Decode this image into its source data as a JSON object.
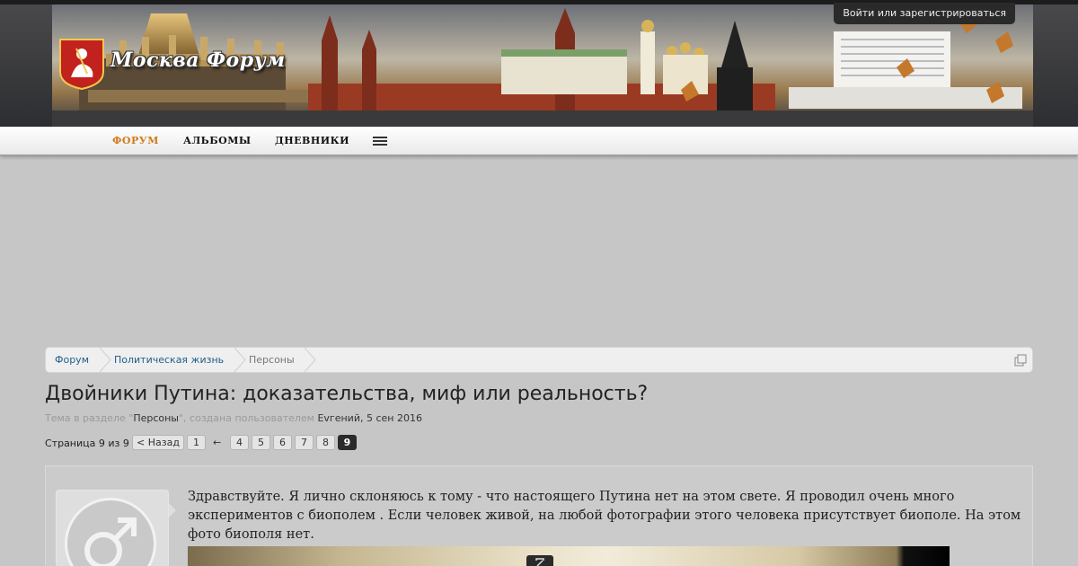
{
  "header": {
    "logo_text": "Москва Форум",
    "login_link": "Войти или зарегистрироваться"
  },
  "nav": {
    "tabs": [
      {
        "label": "ФОРУМ",
        "active": true
      },
      {
        "label": "АЛЬБОМЫ",
        "active": false
      },
      {
        "label": "ДНЕВНИКИ",
        "active": false
      }
    ],
    "menu_icon": "hamburger-icon"
  },
  "breadcrumb": {
    "items": [
      "Форум",
      "Политическая жизнь",
      "Персоны"
    ],
    "right_icon": "popup-icon"
  },
  "thread": {
    "title": "Двойники Путина: доказательства, миф или реальность?",
    "meta": {
      "prefix": "Тема в разделе \"",
      "section": "Персоны",
      "mid": "\", создана пользователем ",
      "author": "Evгений",
      "date": ", 5 сен 2016"
    }
  },
  "pagination": {
    "label": "Страница 9 из 9",
    "prev": "< Назад",
    "first": "1",
    "gap": "←",
    "pages": [
      "4",
      "5",
      "6",
      "7",
      "8",
      "9"
    ],
    "current": "9"
  },
  "post": {
    "avatar_icon": "male-symbol-icon",
    "text": "Здравствуйте. Я лично склоняюсь к тому - что настоящего Путина нет на этом свете. Я проводил очень много экспериментов с биополем . Если человек живой, на любой фотографии этого человека присутствует биополе. На этом фото биополя нет.",
    "image_expand_icon": "expand-icon"
  },
  "colors": {
    "accent": "#d17a1c",
    "link": "#1f5d8c",
    "page_bg": "#c6c6c6",
    "current_page_bg": "#2a2a2a"
  }
}
